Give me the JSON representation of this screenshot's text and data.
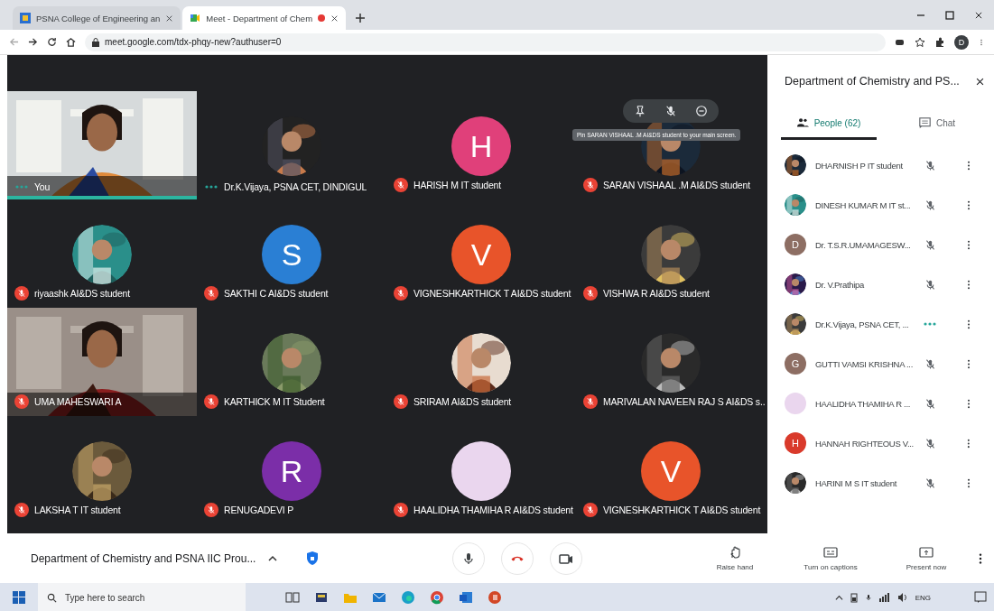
{
  "browser": {
    "tabs": [
      {
        "title": "PSNA College of Engineering an",
        "selected": false,
        "recording": false
      },
      {
        "title": "Meet - Department of Chem",
        "selected": true,
        "recording": true
      }
    ],
    "url": "meet.google.com/tdx-phqy-new?authuser=0",
    "profile": "D"
  },
  "tiles": [
    {
      "name": "You",
      "kind": "video",
      "muted": false,
      "highlighted": true
    },
    {
      "name": "Dr.K.Vijaya, PSNA CET, DINDIGUL",
      "muted": false,
      "highlighted": false
    },
    {
      "name": "HARISH M IT student",
      "kind": "letter",
      "letter": "H",
      "color": "#e0407a",
      "muted": true,
      "highlighted": false
    },
    {
      "name": "SARAN VISHAAL .M AI&DS student",
      "muted": true,
      "highlighted": false,
      "tooltip": "Pin SARAN VISHAAL .M AI&DS student to your main screen."
    },
    {
      "name": "riyaashk AI&DS student",
      "muted": true,
      "highlighted": false
    },
    {
      "name": "SAKTHI C AI&DS student",
      "kind": "letter",
      "letter": "S",
      "color": "#2a7fd4",
      "muted": true,
      "highlighted": false
    },
    {
      "name": "VIGNESHKARTHICK T AI&DS student",
      "kind": "letter",
      "letter": "V",
      "color": "#e8542a",
      "muted": true,
      "highlighted": false
    },
    {
      "name": "VISHWA R AI&DS student",
      "muted": true,
      "highlighted": false
    },
    {
      "name": "UMA MAHESWARI A",
      "kind": "video",
      "muted": true,
      "highlighted": false
    },
    {
      "name": "KARTHICK M IT Student",
      "muted": true,
      "highlighted": false
    },
    {
      "name": "SRIRAM AI&DS student",
      "muted": true,
      "highlighted": false
    },
    {
      "name": "MARIVALAN NAVEEN RAJ S AI&DS s...",
      "muted": true,
      "highlighted": false
    },
    {
      "name": "LAKSHA T IT student",
      "muted": true,
      "highlighted": false
    },
    {
      "name": "RENUGADEVI P",
      "kind": "letter",
      "letter": "R",
      "color": "#7b2ea8",
      "muted": true,
      "highlighted": false
    },
    {
      "name": "HAALIDHA THAMIHA R AI&DS student",
      "kind": "plain",
      "color": "#ead6ee",
      "muted": true,
      "highlighted": false
    },
    {
      "name": "VIGNESHKARTHICK T AI&DS student",
      "kind": "letter",
      "letter": "V",
      "color": "#e8542a",
      "muted": true,
      "highlighted": false
    }
  ],
  "panel": {
    "title": "Department of Chemistry and PS...",
    "tabs": [
      {
        "label": "People (62)",
        "kind": "people",
        "selected": true
      },
      {
        "label": "Chat",
        "kind": "chat",
        "selected": false
      }
    ],
    "people": [
      {
        "name": "DHARNISH P IT student",
        "muted": true
      },
      {
        "name": "DINESH KUMAR M IT st...",
        "muted": true
      },
      {
        "name": "Dr. T.S.R.UMAMAGESW...",
        "kind": "letter",
        "letter": "D",
        "color": "#8d6e63",
        "muted": true
      },
      {
        "name": "Dr. V.Prathipa",
        "muted": true
      },
      {
        "name": "Dr.K.Vijaya, PSNA CET, ...",
        "muted": false
      },
      {
        "name": "GUTTI VAMSI KRISHNA ...",
        "kind": "letter",
        "letter": "G",
        "color": "#8d6e63",
        "muted": true
      },
      {
        "name": "HAALIDHA THAMIHA R ...",
        "kind": "plain",
        "color": "#ead6ee",
        "muted": true
      },
      {
        "name": "HANNAH RIGHTEOUS V...",
        "kind": "letter",
        "letter": "H",
        "color": "#d93a2b",
        "muted": true
      },
      {
        "name": "HARINI M S IT student",
        "muted": true
      }
    ]
  },
  "call_bar": {
    "title": "Department of Chemistry and PSNA IIC Prou...",
    "actions": [
      {
        "label": "Raise hand",
        "kind": "hand"
      },
      {
        "label": "Turn on captions",
        "kind": "captions"
      },
      {
        "label": "Present now",
        "kind": "present"
      }
    ]
  },
  "taskbar": {
    "search": {
      "placeholder": "Type here to search"
    },
    "language": "ENG"
  }
}
